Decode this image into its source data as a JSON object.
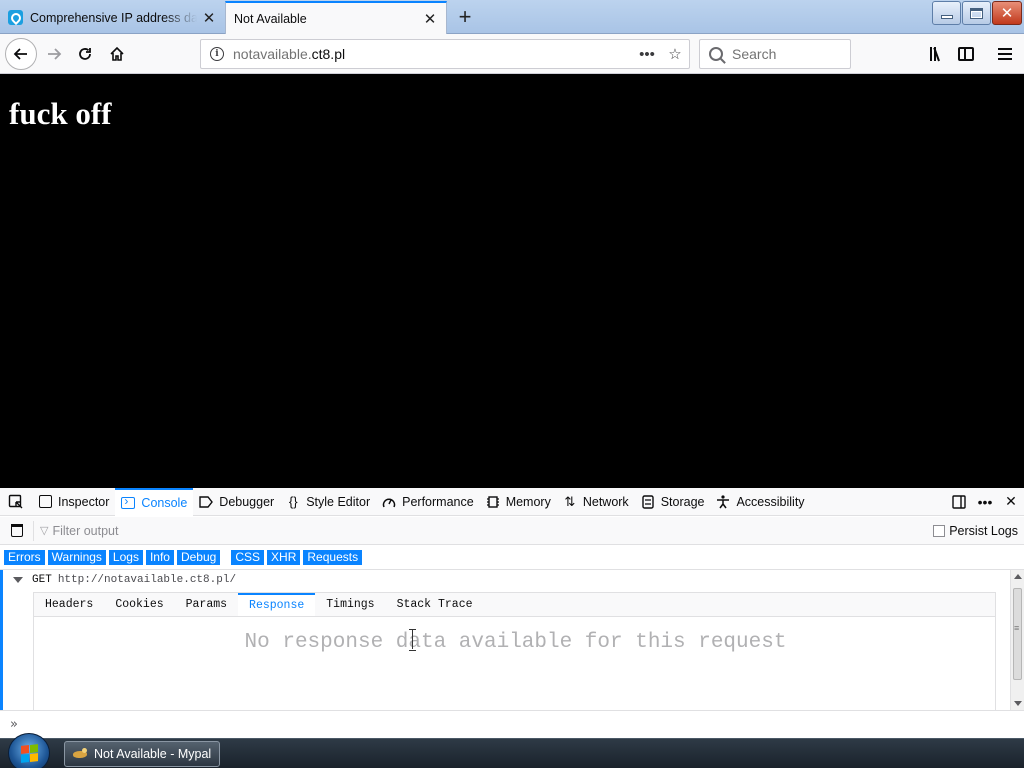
{
  "browser": {
    "tabs": [
      {
        "title": "Comprehensive IP address data, IP geolocation API and database - IPinfo.io",
        "icon": "ipinfo-pin-icon",
        "state": "inactive"
      },
      {
        "title": "Not Available",
        "state": "active"
      }
    ],
    "url": {
      "prefix": "notavailable.",
      "host": "ct8.pl"
    },
    "search_placeholder": "Search"
  },
  "page": {
    "heading": "fuck off",
    "background": "#000000",
    "text_color": "#ffffff"
  },
  "devtools": {
    "tools": [
      {
        "label": "Inspector",
        "icon": "inspector-icon"
      },
      {
        "label": "Console",
        "icon": "console-icon",
        "selected": true
      },
      {
        "label": "Debugger",
        "icon": "debugger-icon"
      },
      {
        "label": "Style Editor",
        "icon": "style-editor-icon"
      },
      {
        "label": "Performance",
        "icon": "performance-icon"
      },
      {
        "label": "Memory",
        "icon": "memory-icon"
      },
      {
        "label": "Network",
        "icon": "network-icon"
      },
      {
        "label": "Storage",
        "icon": "storage-icon"
      },
      {
        "label": "Accessibility",
        "icon": "accessibility-icon"
      }
    ],
    "filter_placeholder": "Filter output",
    "persist_logs": "Persist Logs",
    "categories": [
      "Errors",
      "Warnings",
      "Logs",
      "Info",
      "Debug"
    ],
    "categories_net": [
      "CSS",
      "XHR",
      "Requests"
    ],
    "log": {
      "method": "GET",
      "url": "http://notavailable.ct8.pl/"
    },
    "net_tabs": [
      "Headers",
      "Cookies",
      "Params",
      "Response",
      "Timings",
      "Stack Trace"
    ],
    "selected_net_tab": "Response",
    "empty_message": "No response data available for this request",
    "accent": "#0a84ff"
  },
  "taskbar": {
    "item_label": "Not Available - Mypal"
  }
}
